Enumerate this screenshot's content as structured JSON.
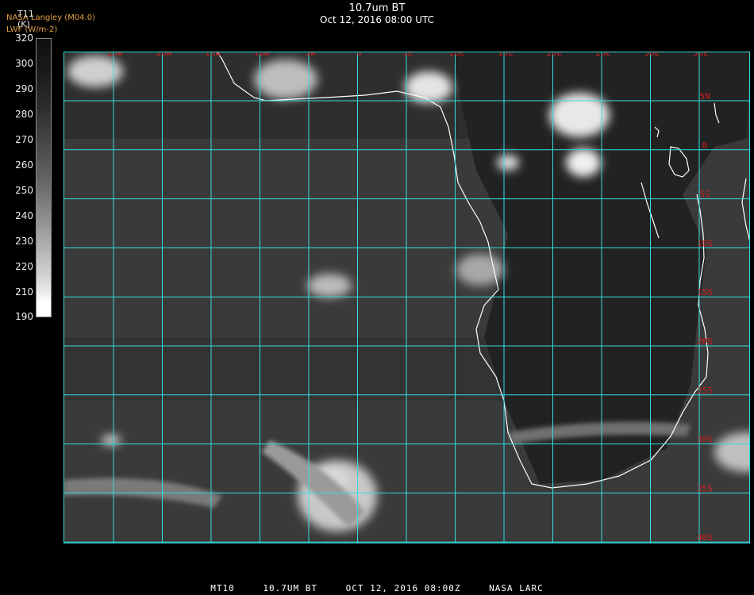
{
  "header": {
    "title": "10.7um BT",
    "subtitle": "Oct 12, 2016 08:00 UTC",
    "credit_line1": "NASA Langley (M04.0)",
    "credit_line2": "LWF (W/m-2)"
  },
  "colorbar": {
    "variable": "T11",
    "unit": "(K)",
    "ticks": [
      "320",
      "300",
      "290",
      "280",
      "270",
      "260",
      "250",
      "240",
      "230",
      "220",
      "210",
      "190"
    ]
  },
  "map": {
    "grid_color": "#33dde0",
    "label_color": "#cc2020",
    "coast_color": "#ffffff",
    "lon_labels": [
      "25W",
      "20W",
      "15W",
      "10W",
      "5W",
      "0",
      "5E",
      "10E",
      "15E",
      "20E",
      "25E",
      "30E",
      "35E"
    ],
    "lat_labels": [
      "5N",
      "0",
      "5S",
      "10S",
      "15S",
      "20S",
      "25S",
      "30S",
      "35S",
      "40S"
    ]
  },
  "footer": {
    "product": "MT10",
    "field": "10.7UM BT",
    "datetime": "OCT 12, 2016 08:00Z",
    "source": "NASA LARC"
  }
}
